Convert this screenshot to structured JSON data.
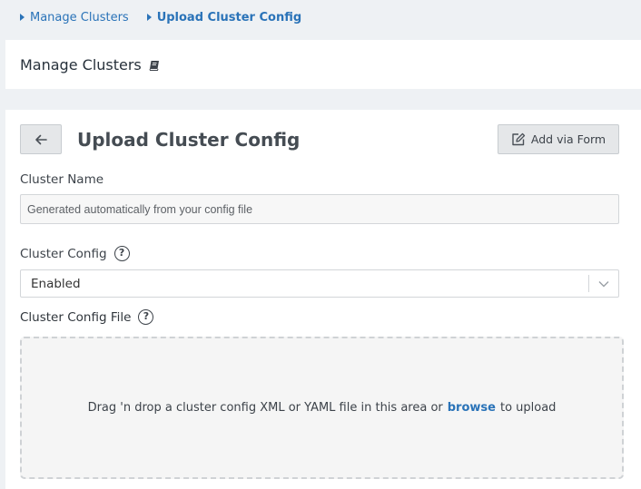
{
  "breadcrumb": {
    "items": [
      {
        "label": "Manage Clusters"
      },
      {
        "label": "Upload Cluster Config"
      }
    ]
  },
  "header": {
    "title": "Manage Clusters",
    "icon": "book-icon"
  },
  "form": {
    "title": "Upload Cluster Config",
    "back_icon": "arrow-left-icon",
    "add_via_form_label": "Add via Form",
    "add_via_form_icon": "edit-icon",
    "cluster_name": {
      "label": "Cluster Name",
      "value": "",
      "placeholder": "Generated automatically from your config file"
    },
    "cluster_config": {
      "label": "Cluster Config",
      "help": "?",
      "selected": "Enabled"
    },
    "cluster_config_file": {
      "label": "Cluster Config File",
      "help": "?",
      "drop_text_before": "Drag 'n drop a cluster config XML or YAML file in this area or",
      "browse_link": "browse",
      "drop_text_after": "to upload"
    }
  },
  "colors": {
    "link": "#2a73b8",
    "background": "#eef1f4",
    "panel": "#ffffff"
  }
}
